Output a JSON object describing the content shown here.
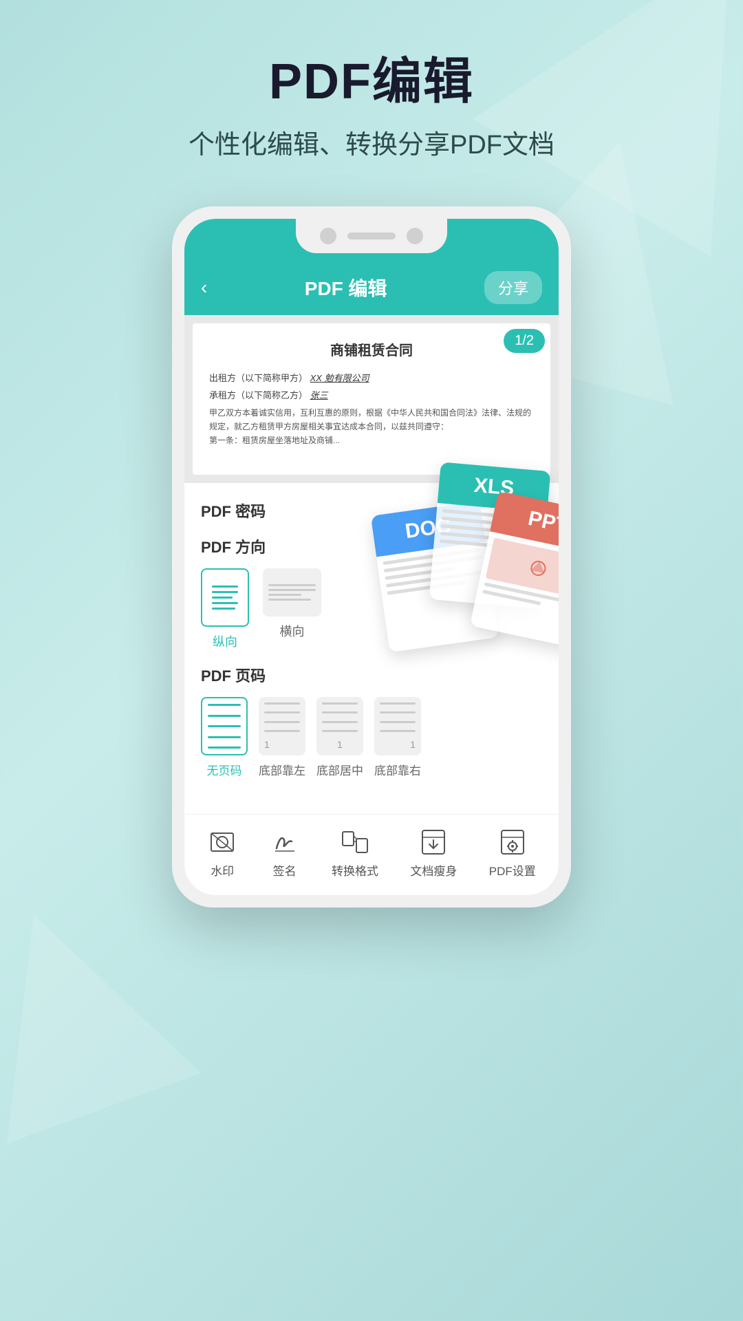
{
  "app": {
    "title": "PDF编辑",
    "subtitle": "个性化编辑、转换分享PDF文档"
  },
  "phone": {
    "header": {
      "back_label": "‹",
      "title": "PDF 编辑",
      "share_label": "分享"
    },
    "pdf": {
      "page_badge": "1/2",
      "doc_title": "商铺租赁合同",
      "line1_label": "出租方（以下简称甲方）",
      "line1_value": "XX 勉有限公司",
      "line2_label": "承租方（以下简称乙方）",
      "line2_value": "张三",
      "body_text": "甲乙双方本着诚实信用，互利互惠的原则，根据《中华人民共和国合同法》法律、法规的规定，就乙方租赁甲方房屋相关事宜达成本合同，以兹共同遵守：",
      "line_extra": "第一条：租赁房屋坐落地址及商铺..."
    },
    "password_section": {
      "title": "PDF 密码"
    },
    "orientation_section": {
      "title": "PDF 方向",
      "options": [
        {
          "label": "纵向",
          "selected": true
        },
        {
          "label": "横向",
          "selected": false
        }
      ]
    },
    "page_number_section": {
      "title": "PDF 页码",
      "options": [
        {
          "label": "无页码",
          "selected": true,
          "number": ""
        },
        {
          "label": "底部靠左",
          "selected": false,
          "number": "1"
        },
        {
          "label": "底部居中",
          "selected": false,
          "number": "1"
        },
        {
          "label": "底部靠右",
          "selected": false,
          "number": "1"
        }
      ]
    },
    "toolbar": {
      "items": [
        {
          "label": "水印",
          "icon": "watermark-icon"
        },
        {
          "label": "签名",
          "icon": "signature-icon"
        },
        {
          "label": "转换格式",
          "icon": "convert-icon"
        },
        {
          "label": "文档瘦身",
          "icon": "compress-icon"
        },
        {
          "label": "PDF设置",
          "icon": "settings-icon"
        }
      ]
    }
  },
  "floating_docs": [
    {
      "type": "DOC",
      "color": "#4a9ef5"
    },
    {
      "type": "XLS",
      "color": "#2bbfb3"
    },
    {
      "type": "PPT",
      "color": "#e07060"
    }
  ],
  "colors": {
    "primary": "#2bbfb3",
    "dark_text": "#1a1a2e",
    "subtitle_text": "#2d4a4a"
  }
}
